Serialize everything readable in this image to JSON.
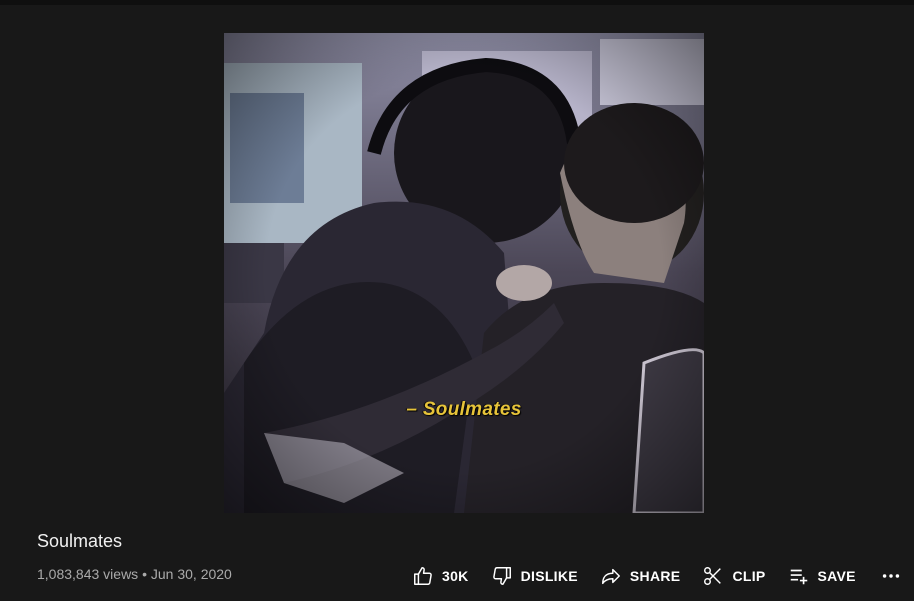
{
  "video": {
    "caption": "– Soulmates",
    "title": "Soulmates",
    "views": "1,083,843 views",
    "separator": "•",
    "date": "Jun 30, 2020"
  },
  "actions": {
    "like_label": "30K",
    "dislike_label": "DISLIKE",
    "share_label": "SHARE",
    "clip_label": "CLIP",
    "save_label": "SAVE",
    "more_icon": "more-horizontal-icon"
  },
  "colors": {
    "background": "#181818",
    "caption": "#e7c43a",
    "meta_text": "#aaaaaa"
  }
}
